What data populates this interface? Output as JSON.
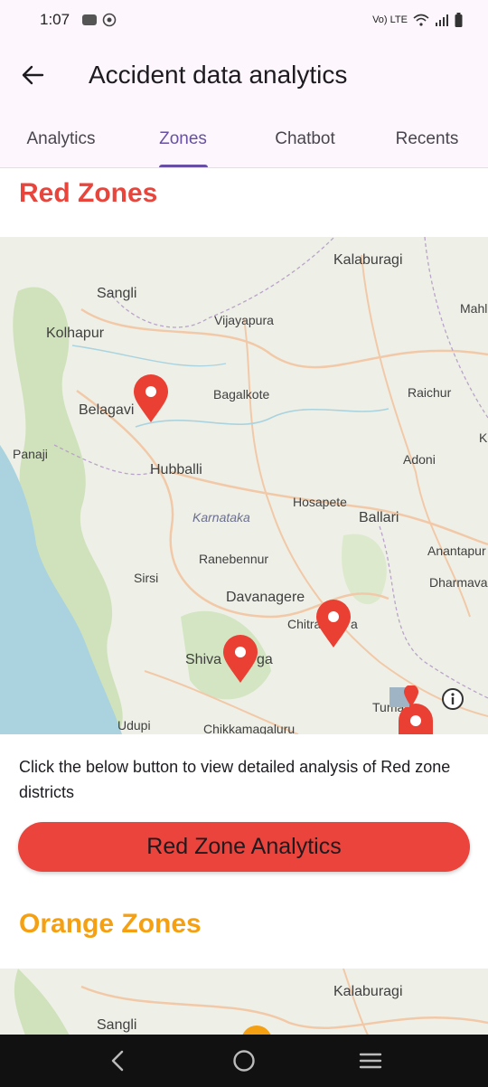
{
  "status_bar": {
    "time": "1:07",
    "network": "Vo) LTE"
  },
  "app_bar": {
    "title": "Accident data analytics"
  },
  "tabs": [
    {
      "label": "Analytics",
      "active": false
    },
    {
      "label": "Zones",
      "active": true
    },
    {
      "label": "Chatbot",
      "active": false
    },
    {
      "label": "Recents",
      "active": false
    }
  ],
  "red_section": {
    "title": "Red Zones",
    "description": "Click the below button to view detailed analysis of Red zone districts",
    "button_label": "Red Zone Analytics"
  },
  "orange_section": {
    "title": "Orange Zones"
  },
  "map": {
    "cities": {
      "kalaburagi": "Kalaburagi",
      "sangli": "Sangli",
      "mahl": "Mahl",
      "kolhapur": "Kolhapur",
      "vijayapura": "Vijayapura",
      "belagavi": "Belagavi",
      "bagalkote": "Bagalkote",
      "raichur": "Raichur",
      "k": "K",
      "panaji": "Panaji",
      "adoni": "Adoni",
      "hubballi": "Hubballi",
      "hosapete": "Hosapete",
      "karnataka": "Karnataka",
      "ballari": "Ballari",
      "anantapur": "Anantapur",
      "ranebennur": "Ranebennur",
      "sirsi": "Sirsi",
      "dharmava": "Dharmava",
      "davanagere": "Davanagere",
      "chitra": "Chitra",
      "a": "a",
      "shiva": "Shiva",
      "ga": "ga",
      "tuma": "Tuma",
      "udupi": "Udupi",
      "chikkamagaluru": "Chikkamagaluru"
    },
    "orange_cities": {
      "kalaburagi": "Kalaburagi",
      "sangli": "Sangli"
    },
    "colors": {
      "water": "#aad3df",
      "land": "#eef0e7",
      "forest": "#c8dfb2",
      "road": "#f2c9a8",
      "marker_red": "#ea3f33",
      "marker_orange": "#f5a012"
    }
  },
  "nav": {
    "back": "back-icon",
    "home": "home-icon",
    "menu": "menu-icon"
  }
}
